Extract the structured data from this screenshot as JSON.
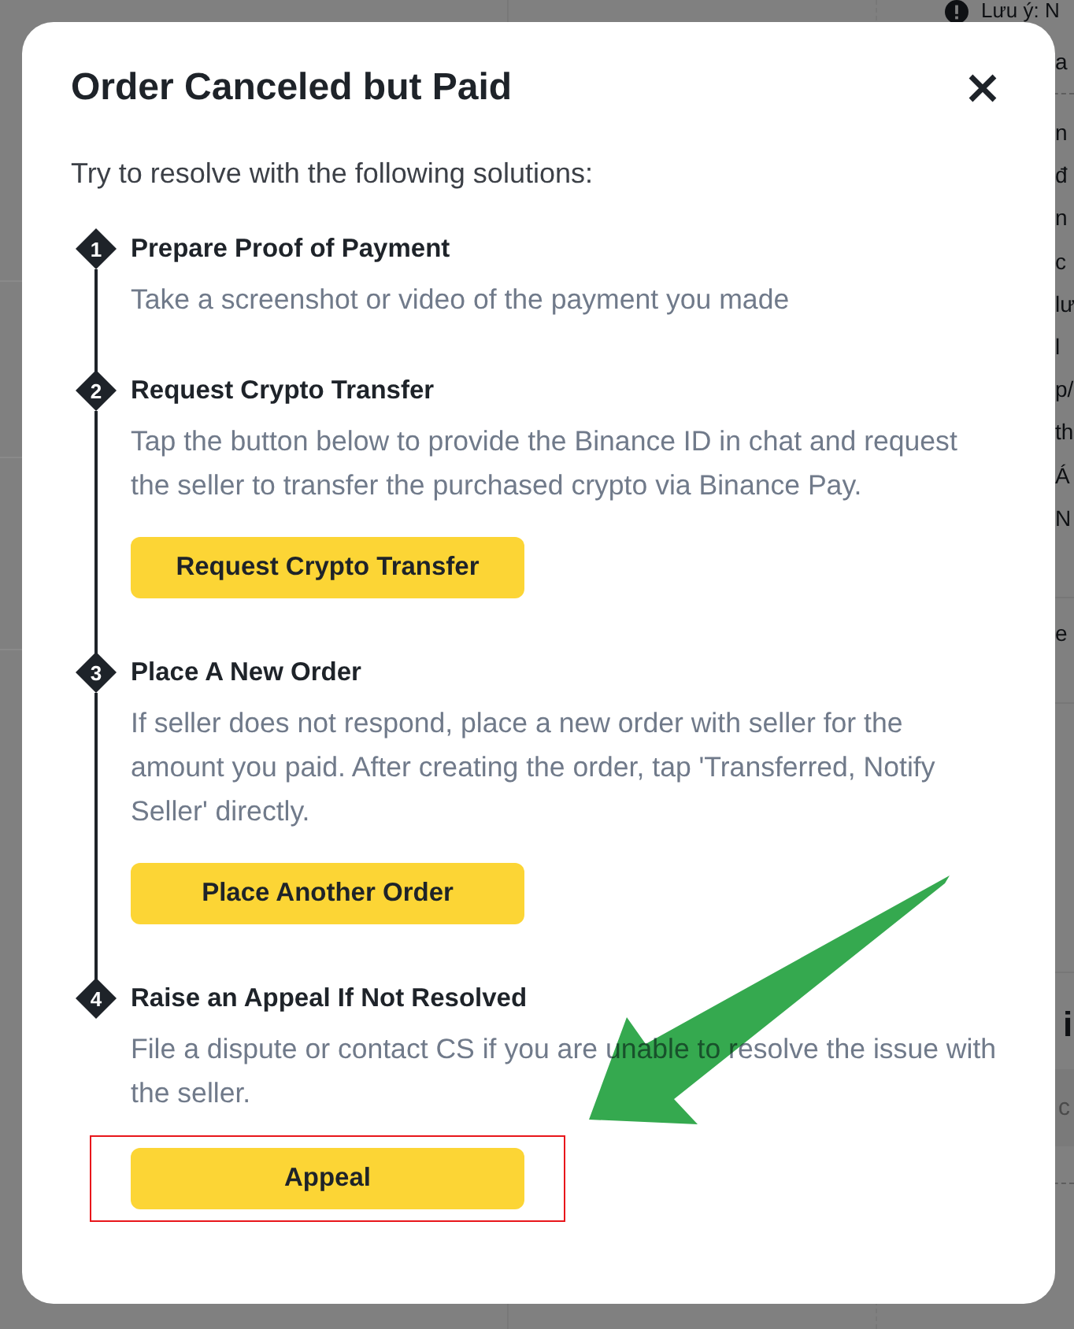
{
  "background_page": {
    "notice": {
      "title": "Lưu ý: N",
      "text": "a"
    },
    "lines": [
      "n",
      "đ",
      "n",
      "c",
      "lư",
      "l",
      "p/",
      "th",
      "Á",
      "N"
    ],
    "row_text": "e",
    "heading": "i",
    "box_text": "c"
  },
  "dialog": {
    "title": "Order Canceled but Paid",
    "intro": "Try to resolve with the following solutions:",
    "steps": [
      {
        "number": "1",
        "title": "Prepare Proof of Payment",
        "description": "Take a screenshot or video of the payment you made"
      },
      {
        "number": "2",
        "title": "Request Crypto Transfer",
        "description": "Tap the button below to provide the Binance ID in chat and request the seller to transfer the purchased crypto via Binance Pay.",
        "button": {
          "label": "Request Crypto Transfer",
          "highlighted": false
        }
      },
      {
        "number": "3",
        "title": "Place A New Order",
        "description": "If seller does not respond, place a new order with seller for the amount you paid. After creating the order, tap 'Transferred, Notify Seller' directly.",
        "button": {
          "label": "Place Another Order",
          "highlighted": false
        }
      },
      {
        "number": "4",
        "title": "Raise an Appeal If Not Resolved",
        "description": "File a dispute or contact CS if you are unable to resolve the issue with the seller.",
        "button": {
          "label": "Appeal",
          "highlighted": true
        }
      }
    ]
  }
}
